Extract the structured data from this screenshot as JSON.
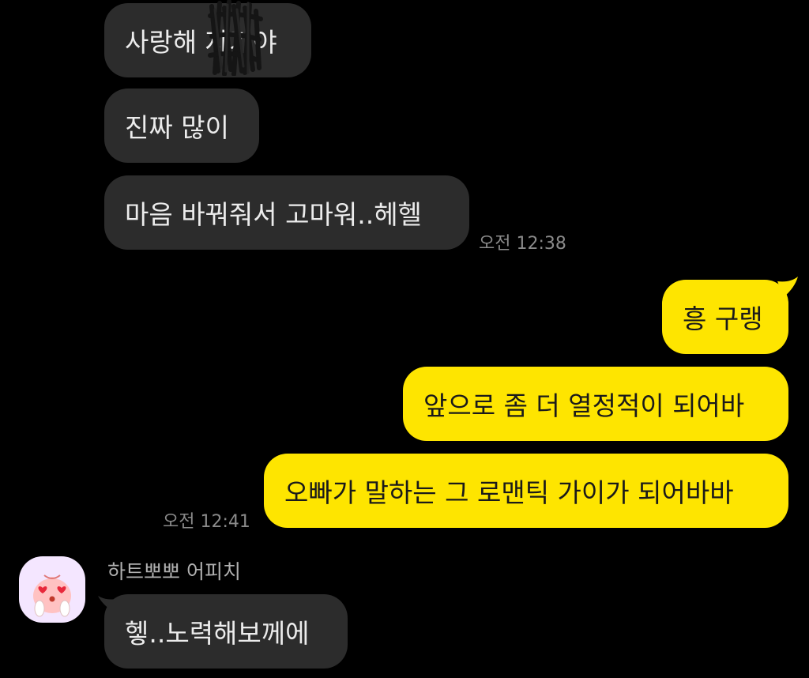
{
  "messages": {
    "m1": "사랑해 자기야",
    "m2": "진짜 많이",
    "m3": "마음 바꿔줘서 고마워..헤헬",
    "t1": "오전 12:38",
    "m4": "흥 구랭",
    "m5": "앞으로 좀 더 열정적이 되어바",
    "m6": "오빠가 말하는 그 로맨틱 가이가 되어바바",
    "t2": "오전 12:41",
    "sender": "하트뽀뽀 어피치",
    "m7": "헿..노력해보께에"
  },
  "colors": {
    "background": "#000000",
    "incoming_bubble": "#2c2c2c",
    "outgoing_bubble": "#fee500"
  },
  "icons": {
    "avatar": "apeach-heart-eyes-icon"
  }
}
